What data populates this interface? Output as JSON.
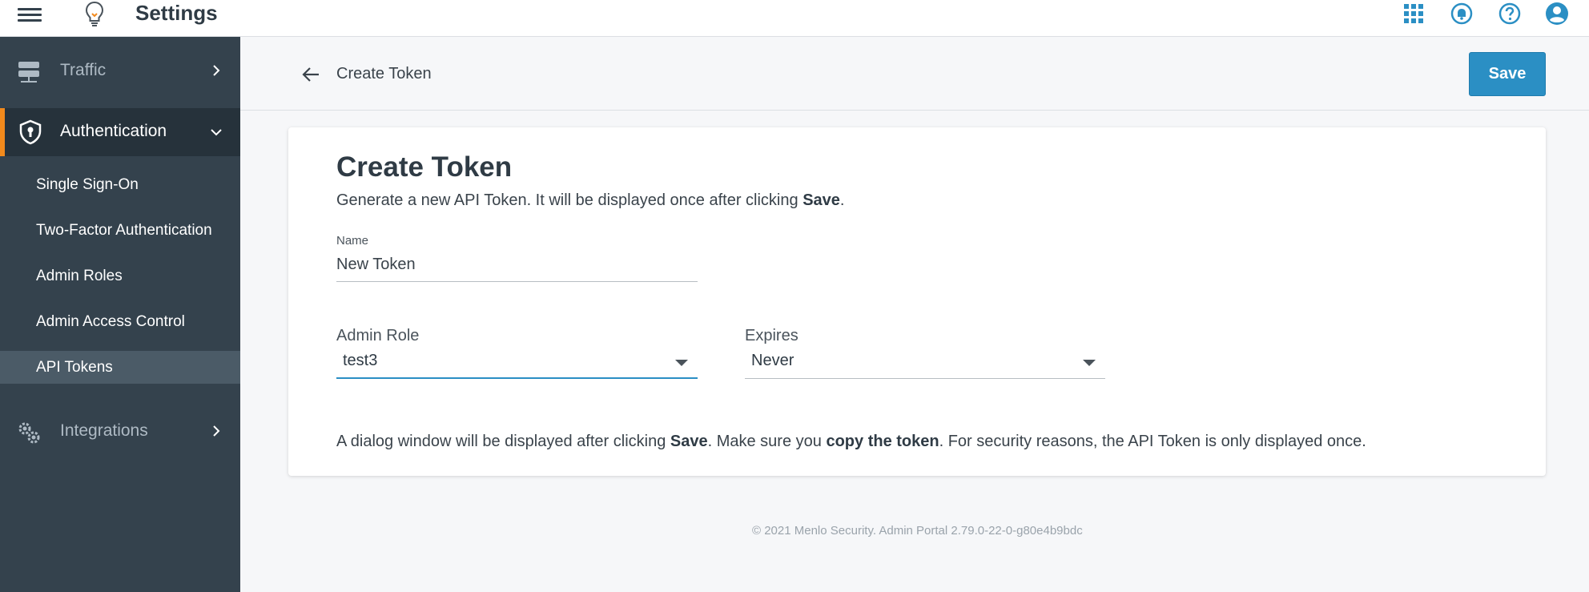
{
  "topbar": {
    "title": "Settings",
    "icons": [
      "menu-icon",
      "lightbulb-icon",
      "apps-grid-icon",
      "notifications-icon",
      "help-icon",
      "account-icon"
    ]
  },
  "sidebar": {
    "sections": [
      {
        "label": "Traffic",
        "icon": "server-icon"
      },
      {
        "label": "Authentication",
        "icon": "shield-icon"
      },
      {
        "label": "Integrations",
        "icon": "gears-icon"
      }
    ],
    "auth_items": [
      {
        "label": "Single Sign-On"
      },
      {
        "label": "Two-Factor Authentication"
      },
      {
        "label": "Admin Roles"
      },
      {
        "label": "Admin Access Control"
      },
      {
        "label": "API Tokens",
        "active": true
      }
    ]
  },
  "header": {
    "title": "Create Token",
    "save_label": "Save"
  },
  "form": {
    "heading": "Create Token",
    "desc_prefix": "Generate a new API Token. It will be displayed once after clicking ",
    "desc_bold": "Save",
    "desc_suffix": ".",
    "name_label": "Name",
    "name_value": "New Token",
    "role_label": "Admin Role",
    "role_value": "test3",
    "expires_label": "Expires",
    "expires_value": "Never",
    "note_1": "A dialog window will be displayed after clicking ",
    "note_bold_1": "Save",
    "note_2": ". Make sure you ",
    "note_bold_2": "copy the token",
    "note_3": ". For security reasons, the API Token is only displayed once."
  },
  "footer": {
    "text": "© 2021 Menlo Security. Admin Portal 2.79.0-22-0-g80e4b9bdc"
  },
  "colors": {
    "accent": "#2b8fc4",
    "sidebar_bg": "#34424d",
    "active_indicator": "#f28a1c"
  }
}
